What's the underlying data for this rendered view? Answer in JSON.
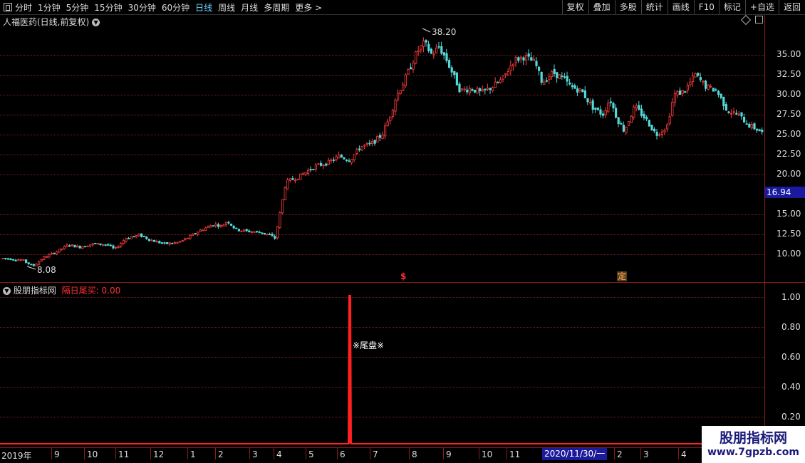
{
  "toolbar": {
    "periods": [
      "分时",
      "1分钟",
      "5分钟",
      "15分钟",
      "30分钟",
      "60分钟",
      "日线",
      "周线",
      "月线",
      "多周期",
      "更多"
    ],
    "active_period": "日线",
    "more_arrow": ">",
    "right_buttons": [
      "复权",
      "叠加",
      "多股",
      "统计",
      "画线",
      "F10",
      "标记",
      "+自选",
      "返回"
    ]
  },
  "main_panel": {
    "title": "人福医药(日线,前复权)",
    "price_ticks": [
      "35.00",
      "32.50",
      "30.00",
      "27.50",
      "25.00",
      "22.50",
      "20.00",
      "15.00",
      "12.50",
      "10.00"
    ],
    "current_price": "16.94",
    "high_label": "38.20",
    "low_label": "8.08",
    "marker_s": "$",
    "marker_ding": "定"
  },
  "indicator_panel": {
    "name": "股朋指标网",
    "indicator_label": "隔日尾买: 0.00",
    "ticks": [
      "1.00",
      "0.80",
      "0.60",
      "0.40",
      "0.20"
    ],
    "signal_label": "※尾盘※"
  },
  "date_axis": {
    "labels": [
      "2019年",
      "9",
      "10",
      "11",
      "12",
      "1",
      "2",
      "3",
      "4",
      "5",
      "6",
      "7",
      "8",
      "9",
      "10",
      "11",
      "2",
      "3",
      "4"
    ],
    "cursor_date": "2020/11/30/一"
  },
  "watermark": {
    "title": "股朋指标网",
    "url": "www.7gpzb.com"
  },
  "colors": {
    "up": "#ff3d3d",
    "down": "#54d8d8",
    "accent": "#6fd6ff",
    "grid": "#7a1f1f",
    "current_price_bg": "#1a1aa0"
  }
}
